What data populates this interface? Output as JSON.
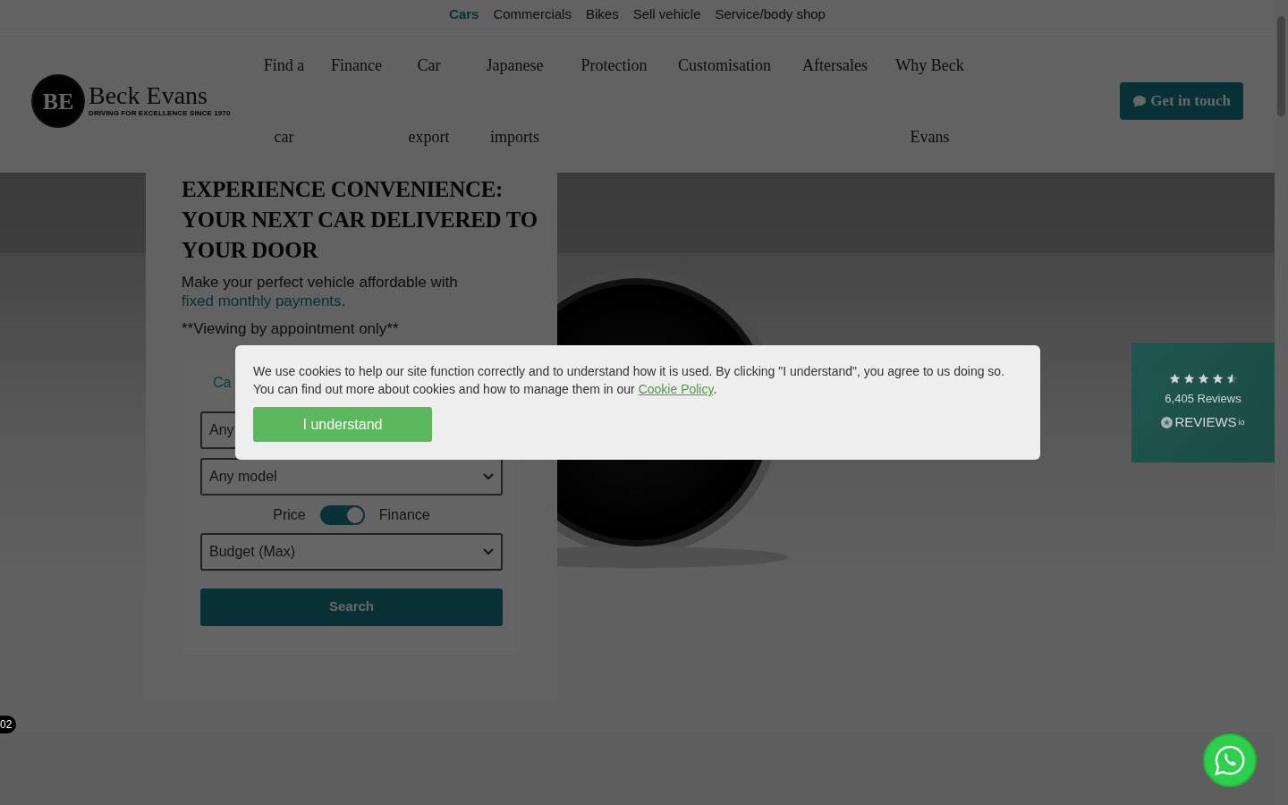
{
  "top_nav": [
    {
      "label": "Cars",
      "selected": true
    },
    {
      "label": "Commercials",
      "selected": false
    },
    {
      "label": "Bikes",
      "selected": false
    },
    {
      "label": "Sell vehicle",
      "selected": false
    },
    {
      "label": "Service/body shop",
      "selected": false
    }
  ],
  "logo": {
    "monogram": "BE",
    "name": "Beck Evans",
    "tagline": "DRIVING FOR EXCELLENCE SINCE 1970"
  },
  "main_nav": [
    {
      "label": "Find a car"
    },
    {
      "label": "Finance"
    },
    {
      "label": "Car export"
    },
    {
      "label": "Japanese imports"
    },
    {
      "label": "Protection"
    },
    {
      "label": "Customisation"
    },
    {
      "label": "Aftersales"
    },
    {
      "label": "Why Beck Evans"
    }
  ],
  "contact_button": {
    "label": "Get in touch"
  },
  "hero": {
    "heading": "EXPERIENCE CONVENIENCE: YOUR NEXT CAR DELIVERED TO YOUR DOOR",
    "intro": "Make your perfect vehicle affordable with",
    "intro_link": "fixed monthly payments",
    "intro_end": ".",
    "note": "**Viewing by appointment only**"
  },
  "search": {
    "tab": "Ca",
    "make": "Any",
    "model": "Any model",
    "price_label": "Price",
    "finance_label": "Finance",
    "finance_mode": true,
    "budget": "Budget (Max)",
    "button": "Search"
  },
  "reviews": {
    "stars": 4.5,
    "count": "6,405 Reviews",
    "brand": "REVIEWS",
    "brand_suffix": "io"
  },
  "slide_badge": "02",
  "cookie_notice": {
    "line_1": "We use cookies to help our site function correctly and to understand how it is used. By clicking \"I understand\", you agree to us doing so.",
    "line_2": "You can find out more about cookies and how to manage them in our",
    "link": "Cookie Policy",
    "end": ".",
    "button": "I understand"
  }
}
